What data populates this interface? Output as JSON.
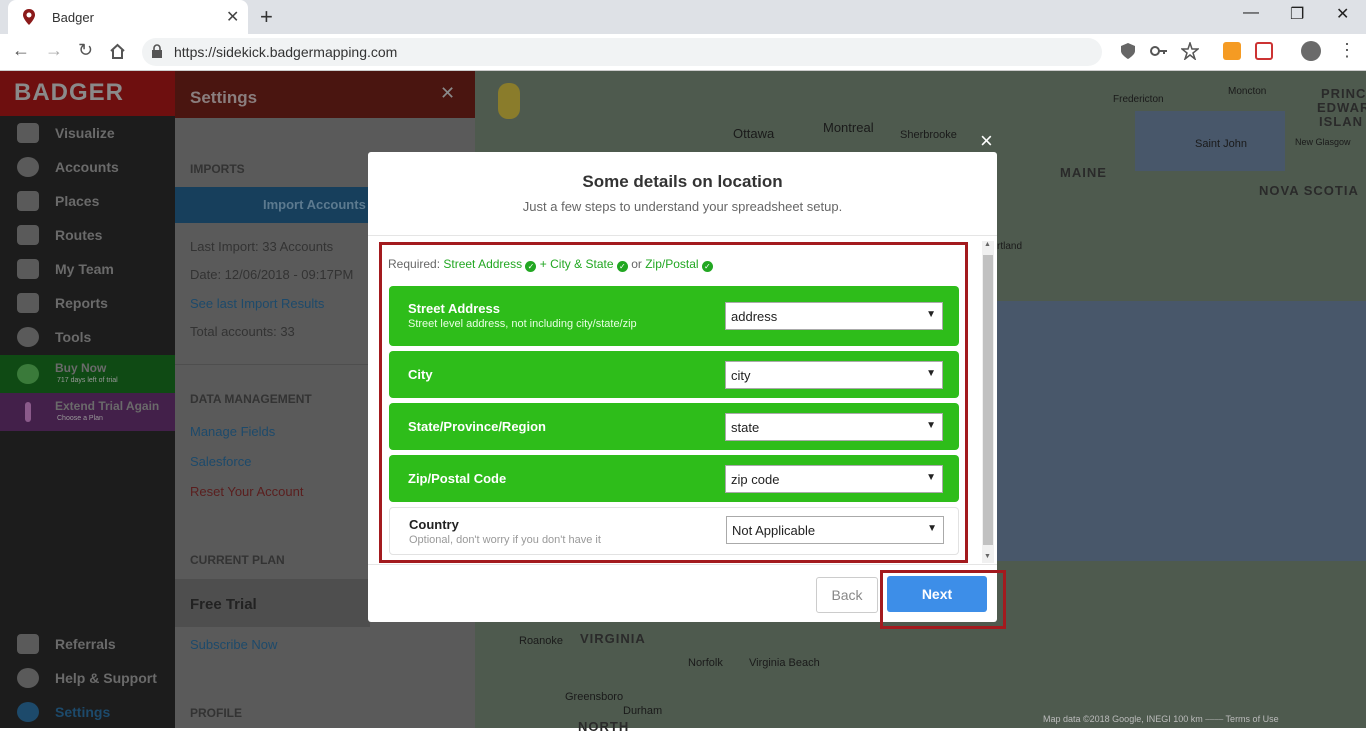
{
  "browser": {
    "tab_title": "Badger",
    "url": "https://sidekick.badgermapping.com",
    "new_tab": "+",
    "tab_close": "✕",
    "min": "—",
    "restore": "❐",
    "close": "✕"
  },
  "sidebar": {
    "logo": "BADGER",
    "items": [
      {
        "label": "Visualize",
        "icon": "eye-icon"
      },
      {
        "label": "Accounts",
        "icon": "person-icon"
      },
      {
        "label": "Places",
        "icon": "store-icon"
      },
      {
        "label": "Routes",
        "icon": "map-icon"
      },
      {
        "label": "My Team",
        "icon": "team-icon"
      },
      {
        "label": "Reports",
        "icon": "report-icon"
      },
      {
        "label": "Tools",
        "icon": "pin-icon"
      }
    ],
    "buy_now": {
      "label": "Buy Now",
      "sub": "717 days left of trial"
    },
    "extend": {
      "label": "Extend Trial Again",
      "sub": "Choose a Plan"
    },
    "bottom_items": [
      {
        "label": "Referrals",
        "icon": "gift-icon"
      },
      {
        "label": "Help & Support",
        "icon": "help-icon"
      },
      {
        "label": "Settings",
        "icon": "gear-icon"
      }
    ]
  },
  "settings": {
    "title": "Settings",
    "close": "✕",
    "imports_label": "IMPORTS",
    "import_button": "Import Accounts",
    "last_import": "Last Import: 33 Accounts",
    "date": "Date: 12/06/2018 - 09:17PM",
    "see_last": "See last Import Results",
    "total": "Total accounts: 33",
    "data_mgmt_label": "DATA MANAGEMENT",
    "manage_fields": "Manage Fields",
    "salesforce": "Salesforce",
    "reset": "Reset Your Account",
    "current_plan_label": "CURRENT PLAN",
    "plan": "Free Trial",
    "subscribe": "Subscribe Now",
    "profile_label": "PROFILE"
  },
  "map": {
    "places": [
      "Ottawa",
      "Montreal",
      "Sherbrooke",
      "Fredericton",
      "Moncton",
      "Saint John",
      "New Glasgow",
      "Roanoke",
      "Norfolk",
      "Virginia Beach",
      "Greensboro",
      "Durham",
      "rtland"
    ],
    "regions": [
      "MAINE",
      "NOVA SCOTIA",
      "VIRGINIA",
      "PRINC",
      "EDWAR",
      "ISLAN",
      "NORTH"
    ],
    "footer": "Map data ©2018 Google, INEGI   100 km ⎯⎯⎯⎯   Terms of Use"
  },
  "modal": {
    "close": "×",
    "title": "Some details on location",
    "subtitle": "Just a few steps to understand your spreadsheet setup.",
    "required_prefix": "Required:",
    "req_street": "Street Address",
    "req_plus": "+",
    "req_city_state": "City & State",
    "req_or": "or",
    "req_zip": "Zip/Postal",
    "rows": [
      {
        "label": "Street Address",
        "desc": "Street level address, not including city/state/zip",
        "value": "address"
      },
      {
        "label": "City",
        "desc": "",
        "value": "city"
      },
      {
        "label": "State/Province/Region",
        "desc": "",
        "value": "state"
      },
      {
        "label": "Zip/Postal Code",
        "desc": "",
        "value": "zip code"
      },
      {
        "label": "Country",
        "desc": "Optional, don't worry if you don't have it",
        "value": "Not Applicable"
      }
    ],
    "back": "Back",
    "next": "Next"
  },
  "colors": {
    "green": "#2ebd1a",
    "highlight": "#a31a1e",
    "next": "#3d8ee8"
  }
}
